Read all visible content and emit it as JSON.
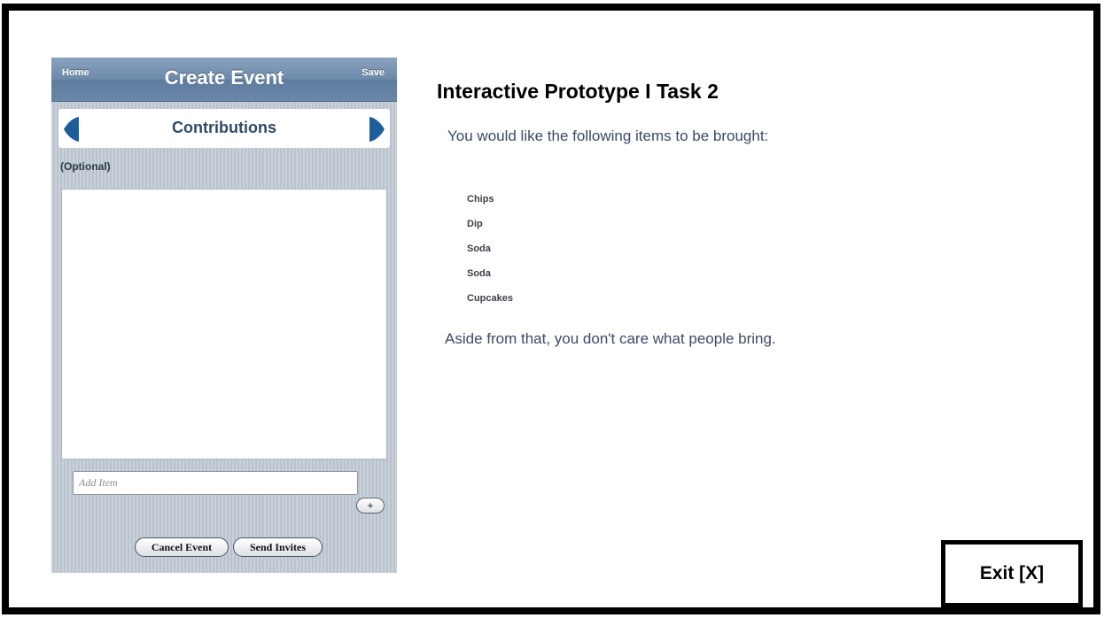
{
  "phone": {
    "nav": {
      "home_label": "Home",
      "title": "Create Event",
      "save_label": "Save"
    },
    "section": {
      "title": "Contributions",
      "prev_icon": "left-arrow-icon",
      "next_icon": "right-arrow-icon"
    },
    "optional_label": "(Optional)",
    "add_item": {
      "placeholder": "Add Item",
      "value": "",
      "add_button_label": "+"
    },
    "buttons": {
      "cancel_label": "Cancel Event",
      "send_label": "Send Invites"
    }
  },
  "task": {
    "title": "Interactive Prototype I Task 2",
    "intro": "You would like the following items to be brought:",
    "items": [
      "Chips",
      "Dip",
      "Soda",
      "Soda",
      "Cupcakes"
    ],
    "outro": "Aside from that, you don't care what people bring."
  },
  "exit": {
    "label": "Exit [X]"
  },
  "colors": {
    "nav_bar": "#6d8aaa",
    "arrow": "#1d5d9b",
    "section_text": "#2e4a66",
    "body_text": "#3b4a66"
  }
}
